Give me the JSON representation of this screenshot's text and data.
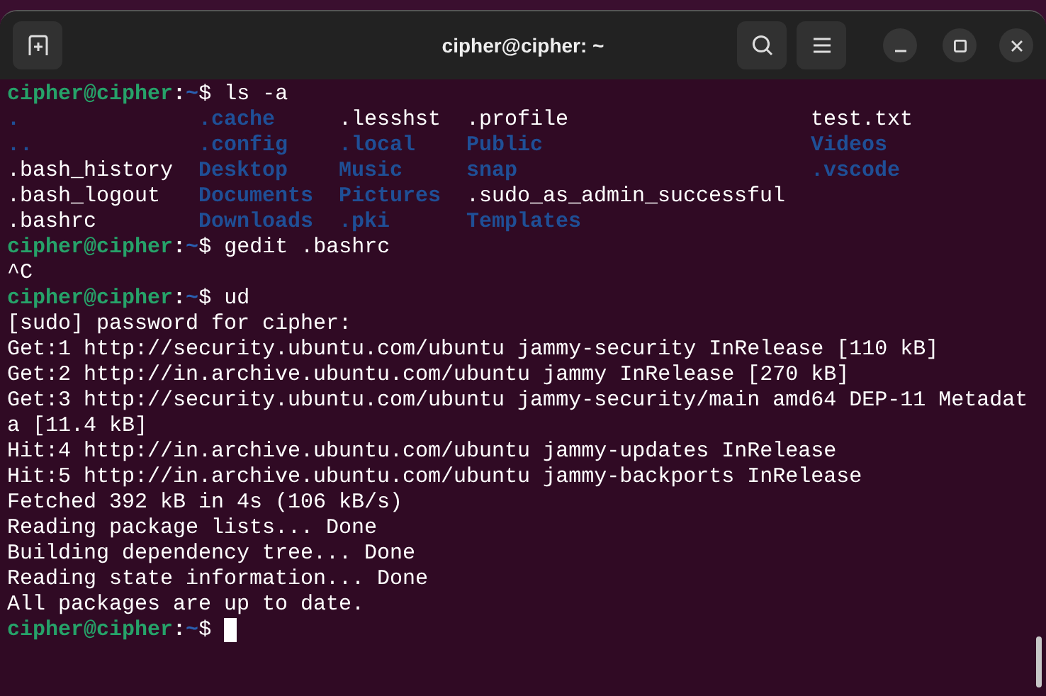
{
  "window": {
    "title": "cipher@cipher: ~"
  },
  "terminal": {
    "blocks": [
      {
        "kind": "prompt",
        "user": "cipher@cipher",
        "separator": ":",
        "path": "~",
        "symbol": "$",
        "command": "ls -a",
        "cursor": false
      },
      {
        "kind": "listing",
        "columns": [
          [
            {
              "name": ".",
              "directory": true
            },
            {
              "name": "..",
              "directory": true
            },
            {
              "name": ".bash_history",
              "directory": false
            },
            {
              "name": ".bash_logout",
              "directory": false
            },
            {
              "name": ".bashrc",
              "directory": false
            }
          ],
          [
            {
              "name": ".cache",
              "directory": true
            },
            {
              "name": ".config",
              "directory": true
            },
            {
              "name": "Desktop",
              "directory": true
            },
            {
              "name": "Documents",
              "directory": true
            },
            {
              "name": "Downloads",
              "directory": true
            }
          ],
          [
            {
              "name": ".lesshst",
              "directory": false
            },
            {
              "name": ".local",
              "directory": true
            },
            {
              "name": "Music",
              "directory": true
            },
            {
              "name": "Pictures",
              "directory": true
            },
            {
              "name": ".pki",
              "directory": true
            }
          ],
          [
            {
              "name": ".profile",
              "directory": false
            },
            {
              "name": "Public",
              "directory": true
            },
            {
              "name": "snap",
              "directory": true
            },
            {
              "name": ".sudo_as_admin_successful",
              "directory": false
            },
            {
              "name": "Templates",
              "directory": true
            }
          ],
          [
            {
              "name": "test.txt",
              "directory": false
            },
            {
              "name": "Videos",
              "directory": true
            },
            {
              "name": ".vscode",
              "directory": true
            }
          ]
        ]
      },
      {
        "kind": "prompt",
        "user": "cipher@cipher",
        "separator": ":",
        "path": "~",
        "symbol": "$",
        "command": "gedit .bashrc",
        "cursor": false
      },
      {
        "kind": "output",
        "text": "^C"
      },
      {
        "kind": "prompt",
        "user": "cipher@cipher",
        "separator": ":",
        "path": "~",
        "symbol": "$",
        "command": "ud",
        "cursor": false
      },
      {
        "kind": "output",
        "text": "[sudo] password for cipher:"
      },
      {
        "kind": "output",
        "text": "Get:1 http://security.ubuntu.com/ubuntu jammy-security InRelease [110 kB]"
      },
      {
        "kind": "output",
        "text": "Get:2 http://in.archive.ubuntu.com/ubuntu jammy InRelease [270 kB]"
      },
      {
        "kind": "output",
        "text": "Get:3 http://security.ubuntu.com/ubuntu jammy-security/main amd64 DEP-11 Metadat"
      },
      {
        "kind": "output",
        "text": "a [11.4 kB]"
      },
      {
        "kind": "output",
        "text": "Hit:4 http://in.archive.ubuntu.com/ubuntu jammy-updates InRelease"
      },
      {
        "kind": "output",
        "text": "Hit:5 http://in.archive.ubuntu.com/ubuntu jammy-backports InRelease"
      },
      {
        "kind": "output",
        "text": "Fetched 392 kB in 4s (106 kB/s)"
      },
      {
        "kind": "output",
        "text": "Reading package lists... Done"
      },
      {
        "kind": "output",
        "text": "Building dependency tree... Done"
      },
      {
        "kind": "output",
        "text": "Reading state information... Done"
      },
      {
        "kind": "output",
        "text": "All packages are up to date."
      },
      {
        "kind": "prompt",
        "user": "cipher@cipher",
        "separator": ":",
        "path": "~",
        "symbol": "$",
        "cursor": true
      }
    ]
  }
}
